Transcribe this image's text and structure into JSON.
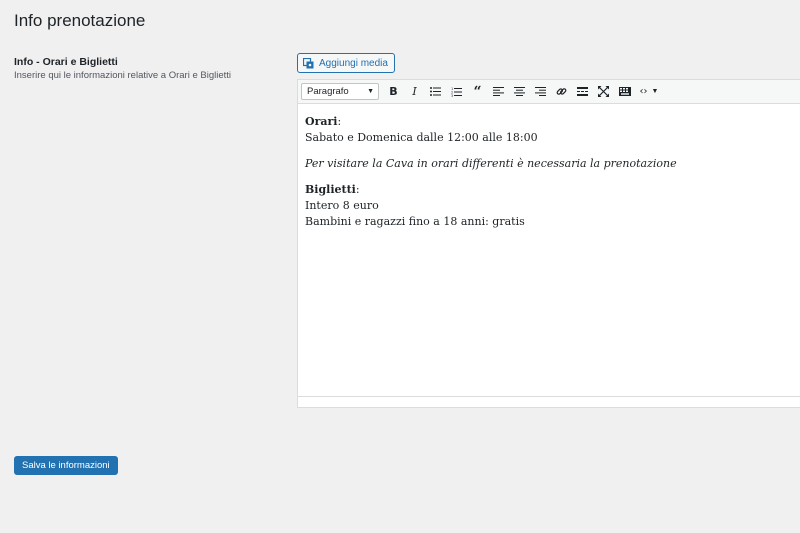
{
  "page": {
    "title": "Info prenotazione"
  },
  "field": {
    "label": "Info - Orari e Biglietti",
    "description": "Inserire qui le informazioni relative a Orari e Biglietti"
  },
  "editor": {
    "add_media_label": "Aggiungi media",
    "format_select": "Paragrafo",
    "toolbar_icons": [
      "bold-icon",
      "italic-icon",
      "bullet-list-icon",
      "numbered-list-icon",
      "blockquote-icon",
      "align-left-icon",
      "align-center-icon",
      "align-right-icon",
      "link-icon",
      "read-more-icon",
      "fullscreen-icon",
      "keyboard-icon",
      "code-icon"
    ],
    "content": {
      "orari_label": "Orari",
      "orari_colon": ":",
      "orari_text": "Sabato e Domenica dalle 12:00 alle 18:00",
      "note": "Per visitare la Cava in orari differenti è necessaria la prenotazione",
      "biglietti_label": "Biglietti",
      "biglietti_colon": ":",
      "intero": "Intero 8 euro",
      "bambini": "Bambini e ragazzi fino a 18 anni: gratis"
    }
  },
  "actions": {
    "save_label": "Salva le informazioni"
  },
  "colors": {
    "accent": "#2271b1",
    "background": "#f0f0f1"
  }
}
